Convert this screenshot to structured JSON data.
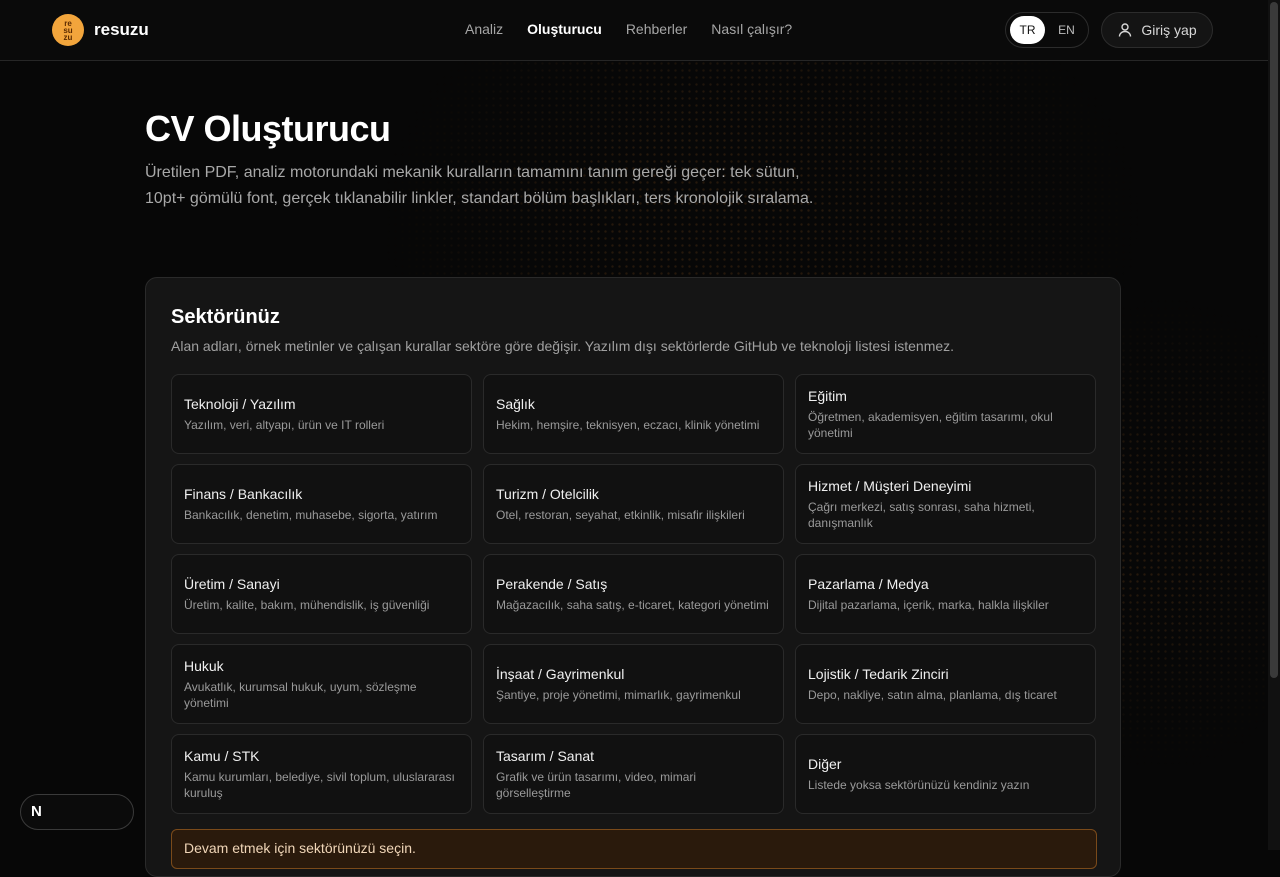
{
  "header": {
    "logo_mark": "re su zu",
    "brand": "resuzu",
    "nav": [
      {
        "label": "Analiz",
        "active": false
      },
      {
        "label": "Oluşturucu",
        "active": true
      },
      {
        "label": "Rehberler",
        "active": false
      },
      {
        "label": "Nasıl çalışır?",
        "active": false
      }
    ],
    "lang": {
      "tr": "TR",
      "en": "EN",
      "selected": "TR"
    },
    "login_label": "Giriş yap"
  },
  "page": {
    "title": "CV Oluşturucu",
    "lead": "Üretilen PDF, analiz motorundaki mekanik kuralların tamamını tanım gereği geçer: tek sütun, 10pt+ gömülü font, gerçek tıklanabilir linkler, standart bölüm başlıkları, ters kronolojik sıralama."
  },
  "sector": {
    "heading": "Sektörünüz",
    "description": "Alan adları, örnek metinler ve çalışan kurallar sektöre göre değişir. Yazılım dışı sektörlerde GitHub ve teknoloji listesi istenmez.",
    "cards": [
      {
        "title": "Teknoloji / Yazılım",
        "desc": "Yazılım, veri, altyapı, ürün ve IT rolleri"
      },
      {
        "title": "Sağlık",
        "desc": "Hekim, hemşire, teknisyen, eczacı, klinik yönetimi"
      },
      {
        "title": "Eğitim",
        "desc": "Öğretmen, akademisyen, eğitim tasarımı, okul yönetimi"
      },
      {
        "title": "Finans / Bankacılık",
        "desc": "Bankacılık, denetim, muhasebe, sigorta, yatırım"
      },
      {
        "title": "Turizm / Otelcilik",
        "desc": "Otel, restoran, seyahat, etkinlik, misafir ilişkileri"
      },
      {
        "title": "Hizmet / Müşteri Deneyimi",
        "desc": "Çağrı merkezi, satış sonrası, saha hizmeti, danışmanlık"
      },
      {
        "title": "Üretim / Sanayi",
        "desc": "Üretim, kalite, bakım, mühendislik, iş güvenliği"
      },
      {
        "title": "Perakende / Satış",
        "desc": "Mağazacılık, saha satış, e-ticaret, kategori yönetimi"
      },
      {
        "title": "Pazarlama / Medya",
        "desc": "Dijital pazarlama, içerik, marka, halkla ilişkiler"
      },
      {
        "title": "Hukuk",
        "desc": "Avukatlık, kurumsal hukuk, uyum, sözleşme yönetimi"
      },
      {
        "title": "İnşaat / Gayrimenkul",
        "desc": "Şantiye, proje yönetimi, mimarlık, gayrimenkul"
      },
      {
        "title": "Lojistik / Tedarik Zinciri",
        "desc": "Depo, nakliye, satın alma, planlama, dış ticaret"
      },
      {
        "title": "Kamu / STK",
        "desc": "Kamu kurumları, belediye, sivil toplum, uluslararası kuruluş"
      },
      {
        "title": "Tasarım / Sanat",
        "desc": "Grafik ve ürün tasarımı, video, mimari görselleştirme"
      },
      {
        "title": "Diğer",
        "desc": "Listede yoksa sektörünüzü kendiniz yazın"
      }
    ],
    "warning": "Devam etmek için sektörünüzü seçin."
  },
  "badge": {
    "label": "N"
  },
  "colors": {
    "accent": "#f2a53c",
    "background": "#070707",
    "panel": "#151515"
  }
}
